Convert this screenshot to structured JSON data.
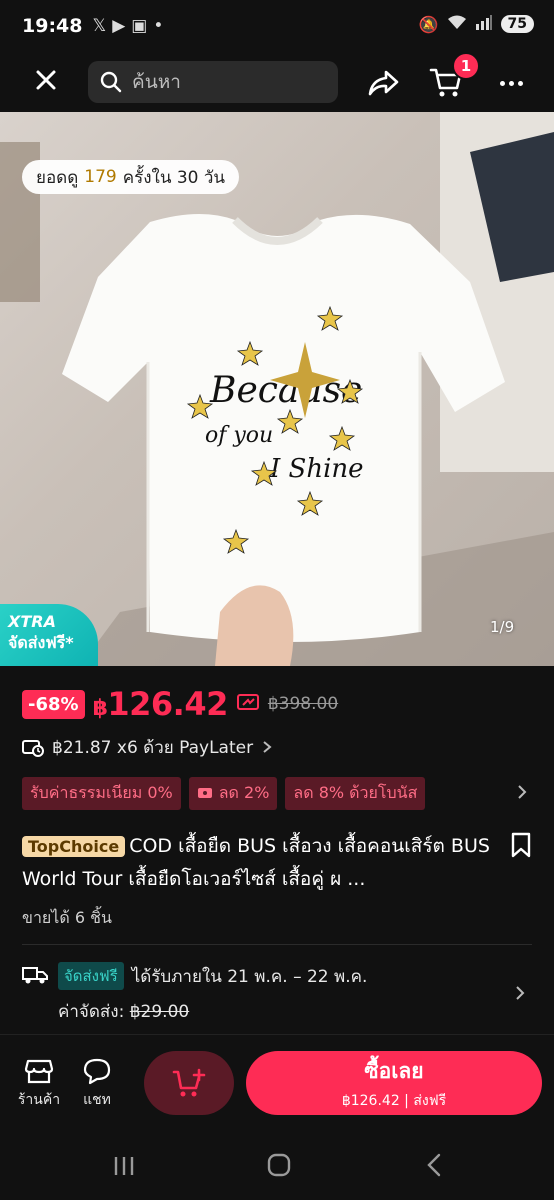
{
  "status_bar": {
    "time": "19:48",
    "battery": "75"
  },
  "top_nav": {
    "search_placeholder": "ค้นหา",
    "cart_count": "1"
  },
  "image": {
    "views_prefix": "ยอดดู",
    "views_count": "179",
    "views_suffix": "ครั้งใน 30 วัน",
    "xtra_title": "XTRA",
    "xtra_sub": "จัดส่งฟรี*",
    "counter": "1/9"
  },
  "price": {
    "discount": "-68%",
    "currency": "฿",
    "current": "126.42",
    "original": "฿398.00"
  },
  "paylater": {
    "text": "฿21.87 x6 ด้วย PayLater"
  },
  "promos": [
    {
      "label": "รับค่าธรรมเนียม 0%"
    },
    {
      "label": "ลด 2%"
    },
    {
      "label": "ลด 8% ด้วยโบนัส"
    }
  ],
  "product": {
    "badge": "TopChoice",
    "title": "COD เสื้อยืด BUS เสื้อวง เสื้อคอนเสิร์ต BUS World Tour เสื้อยืดโอเวอร์ไซส์ เสื้อคู่ ผ ...",
    "sold": "ขายได้ 6 ชิ้น"
  },
  "shipping": {
    "free_tag": "จัดส่งฟรี",
    "delivery": "ได้รับภายใน 21 พ.ค. – 22 พ.ค.",
    "fee_label": "ค่าจัดส่ง:",
    "fee_old": "฿29.00"
  },
  "bottom_bar": {
    "shop_label": "ร้านค้า",
    "chat_label": "แชท",
    "buy_label": "ซื้อเลย",
    "buy_price": "฿126.42",
    "buy_free": "ส่งฟรี"
  },
  "colors": {
    "accent": "#fe2c55",
    "teal": "#2ad1c7",
    "background": "#111111"
  }
}
